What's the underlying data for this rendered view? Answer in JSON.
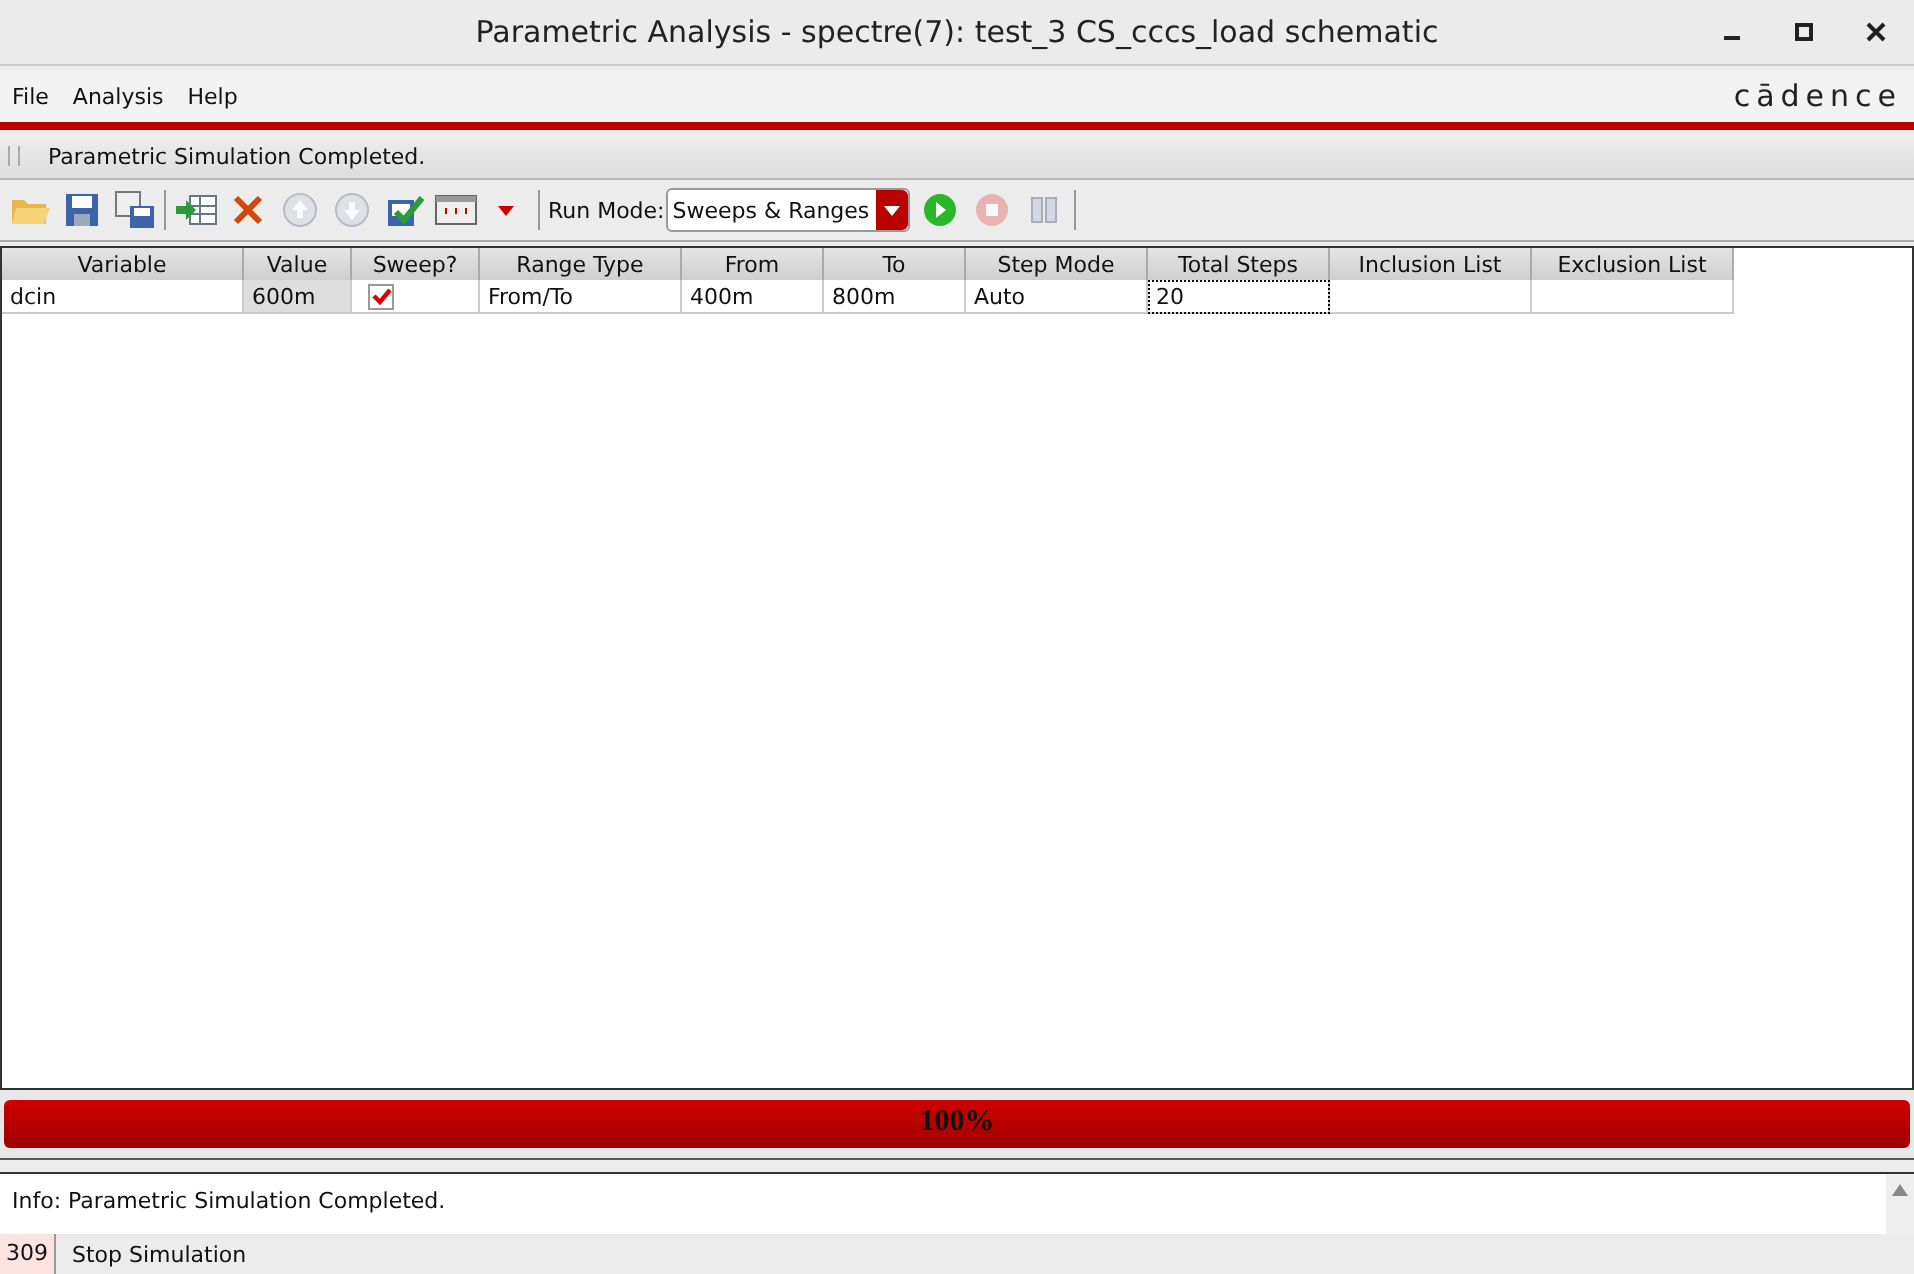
{
  "window": {
    "title": "Parametric Analysis - spectre(7): test_3 CS_cccs_load schematic"
  },
  "menu": [
    "File",
    "Analysis",
    "Help"
  ],
  "logo": "cādence",
  "message": "Parametric Simulation Completed.",
  "toolbar": [
    {
      "kind": "open",
      "disabled": false
    },
    {
      "kind": "save",
      "disabled": false
    },
    {
      "kind": "save-as",
      "disabled": false
    },
    {
      "kind": "separator"
    },
    {
      "kind": "add",
      "disabled": false
    },
    {
      "kind": "delete",
      "disabled": false
    },
    {
      "kind": "up",
      "disabled": true
    },
    {
      "kind": "down",
      "disabled": true
    },
    {
      "kind": "check",
      "disabled": false
    },
    {
      "kind": "table",
      "disabled": false
    },
    {
      "kind": "caret",
      "disabled": false
    },
    {
      "kind": "separator"
    },
    {
      "kind": "mode",
      "label": "Run Mode:",
      "value": "Sweeps & Ranges"
    },
    {
      "kind": "run",
      "disabled": false
    },
    {
      "kind": "stop",
      "disabled": true
    },
    {
      "kind": "pause",
      "disabled": true
    },
    {
      "kind": "separator"
    }
  ],
  "table": {
    "columns": [
      "Variable",
      "Value",
      "Sweep?",
      "Range Type",
      "From",
      "To",
      "Step Mode",
      "Total Steps",
      "Inclusion List",
      "Exclusion List"
    ],
    "rows": [
      {
        "variable": "dcin",
        "value": "600m",
        "sweep": true,
        "range_type": "From/To",
        "from": "400m",
        "to": "800m",
        "step_mode": "Auto",
        "total_steps": "20"
      }
    ]
  },
  "progress": {
    "level": 1,
    "label": "100%"
  },
  "log": [
    "Info: Parametric Simulation Completed."
  ],
  "status_bar": {
    "count": "309",
    "text": "Stop Simulation"
  }
}
